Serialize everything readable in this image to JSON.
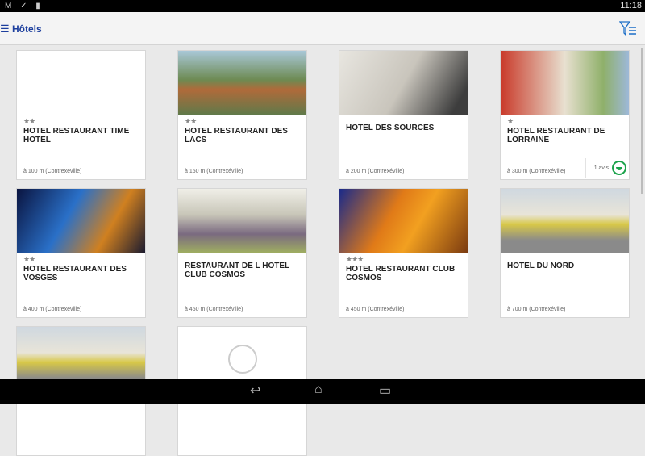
{
  "status": {
    "time": "11:18",
    "left_icons": "M ✓ ▮"
  },
  "appbar": {
    "title": "Hôtels",
    "menu_icon": "☰"
  },
  "hotels": [
    {
      "name": "HOTEL RESTAURANT TIME HOTEL",
      "stars": "★★",
      "distance": "à 100 m (Contrexéville)",
      "img": "#ffffff"
    },
    {
      "name": "HOTEL RESTAURANT DES LACS",
      "stars": "★★",
      "distance": "à 150 m (Contrexéville)",
      "img": "linear-gradient(#a9c8d8 0%,#6d8a52 45%,#b06a3a 60%,#5d7a4a 100%)"
    },
    {
      "name": "HOTEL DES SOURCES",
      "stars": "",
      "distance": "à 200 m (Contrexéville)",
      "img": "linear-gradient(120deg,#e8e6e0,#c9c5bc 50%,#3d3d3d 90%)"
    },
    {
      "name": "HOTEL RESTAURANT DE LORRAINE",
      "stars": "★",
      "distance": "à 300 m (Contrexéville)",
      "img": "linear-gradient(90deg,#c93a2a,#e8e0d0 50%,#8fb06a 80%,#9db8d8)",
      "reviews": "1 avis"
    },
    {
      "name": "HOTEL RESTAURANT DES VOSGES",
      "stars": "★★",
      "distance": "à 400 m (Contrexéville)",
      "img": "linear-gradient(120deg,#0a1440,#2a70c8 40%,#d08020 70%,#1a1a30)"
    },
    {
      "name": "RESTAURANT DE L HOTEL CLUB COSMOS",
      "stars": "",
      "distance": "à 450 m (Contrexéville)",
      "img": "linear-gradient(#f0efe8,#c8c6b8 40%,#7a6a80 70%,#a0b060)"
    },
    {
      "name": "HOTEL RESTAURANT CLUB COSMOS",
      "stars": "★★★",
      "distance": "à 450 m (Contrexéville)",
      "img": "linear-gradient(120deg,#1a2a8a,#e07a18 40%,#f2a020 60%,#7a3a10)"
    },
    {
      "name": "HOTEL DU NORD",
      "stars": "",
      "distance": "à 700 m (Contrexéville)",
      "img": "linear-gradient(#cfd8e0,#e8e4d8 40%,#d8c848 55%,#8a8a8a 80%)"
    },
    {
      "name": "",
      "stars": "",
      "distance": "",
      "img": "linear-gradient(#cfd8e0,#e8e4d8 40%,#d8c848 55%,#8a8a8a 80%)"
    },
    {
      "name": "",
      "stars": "",
      "distance": "",
      "img": "#ffffff",
      "placeholder": true
    }
  ]
}
